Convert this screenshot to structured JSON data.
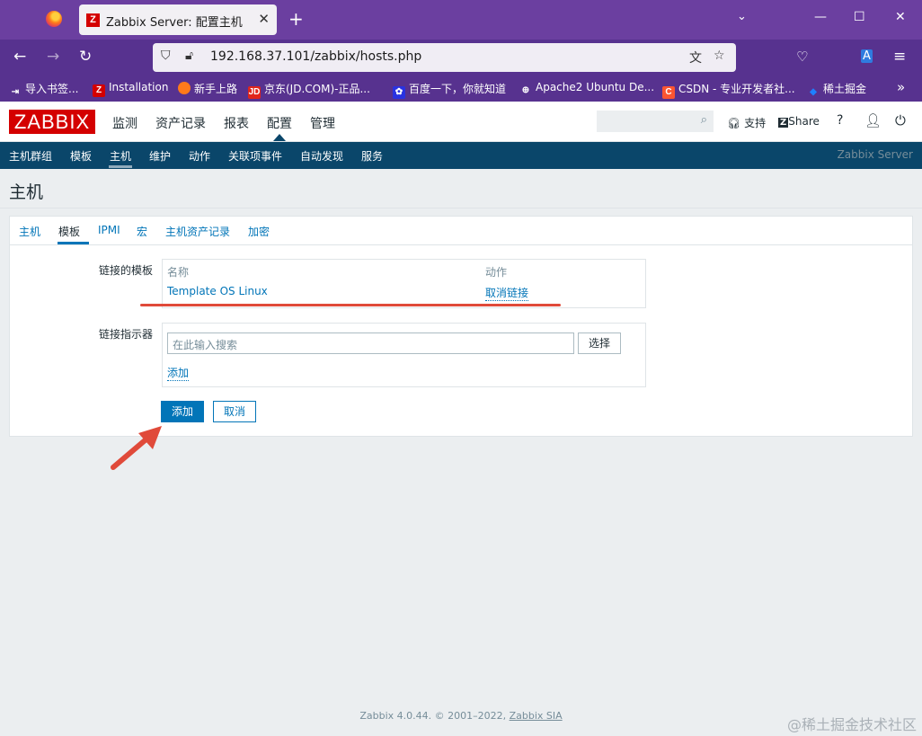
{
  "browser": {
    "tab_title": "Zabbix Server: 配置主机",
    "tab_favicon": "Z",
    "url": "192.168.37.101/zabbix/hosts.php",
    "bookmarks": [
      {
        "label": "导入书签...",
        "icon": "import-icon",
        "color": "#57328f"
      },
      {
        "label": "Installation",
        "icon": "Z",
        "color": "#d40000"
      },
      {
        "label": "新手上路",
        "icon": "firefox-icon",
        "color": "#ff7a1a"
      },
      {
        "label": "京东(JD.COM)-正品...",
        "icon": "JD",
        "color": "#e1251b"
      },
      {
        "label": "百度一下，你就知道",
        "icon": "baidu-icon",
        "color": "#2932e1"
      },
      {
        "label": "Apache2 Ubuntu De...",
        "icon": "globe-icon",
        "color": "#57328f"
      },
      {
        "label": "CSDN - 专业开发者社...",
        "icon": "C",
        "color": "#fc5531"
      },
      {
        "label": "稀土掘金",
        "icon": "juejin-icon",
        "color": "#1e80ff"
      }
    ]
  },
  "zabbix": {
    "logo": "ZABBIX",
    "main_menu": [
      "监测",
      "资产记录",
      "报表",
      "配置",
      "管理"
    ],
    "header_links": {
      "support": "支持",
      "share": "Share",
      "help": "?"
    },
    "sub_menu": [
      "主机群组",
      "模板",
      "主机",
      "维护",
      "动作",
      "关联项事件",
      "自动发现",
      "服务"
    ],
    "server_name": "Zabbix Server",
    "page_title": "主机",
    "form_tabs": [
      "主机",
      "模板",
      "IPMI",
      "宏",
      "主机资产记录",
      "加密"
    ],
    "linked_templates": {
      "label": "链接的模板",
      "col_name": "名称",
      "col_action": "动作",
      "template_name": "Template OS Linux",
      "unlink": "取消链接"
    },
    "link_indicator": {
      "label": "链接指示器",
      "placeholder": "在此输入搜索",
      "select_button": "选择",
      "add_link": "添加"
    },
    "buttons": {
      "add": "添加",
      "cancel": "取消"
    },
    "footer": {
      "text": "Zabbix 4.0.44. © 2001–2022,",
      "company": "Zabbix SIA"
    }
  },
  "watermark": "@稀土掘金技术社区",
  "colors": {
    "accent": "#0275b8",
    "brand": "#d40000",
    "submenu": "#0a466a",
    "browser": "#57328f"
  }
}
